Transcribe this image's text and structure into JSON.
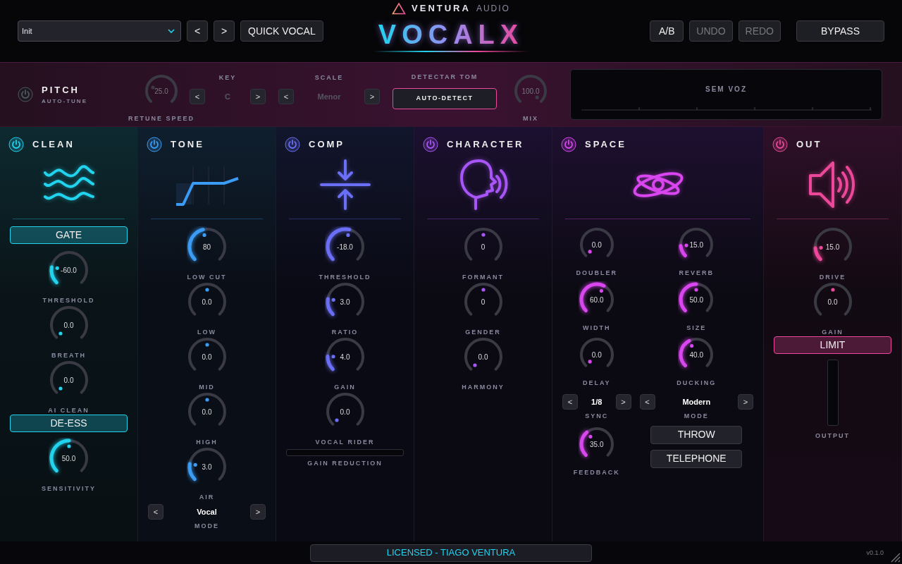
{
  "header": {
    "preset": {
      "value": "Init"
    },
    "nav": [
      "<",
      ">"
    ],
    "quick_vocal": "QUICK VOCAL",
    "brand": {
      "name": "VENTURA",
      "suffix": "AUDIO"
    },
    "title": "VOCALX",
    "buttons": [
      {
        "label": "A/B",
        "disabled": false
      },
      {
        "label": "UNDO",
        "disabled": true
      },
      {
        "label": "REDO",
        "disabled": true
      }
    ],
    "bypass": "BYPASS"
  },
  "pitch": {
    "on": false,
    "title": "PITCH",
    "subtitle": "AUTO-TUNE",
    "retune": {
      "value": "25.0",
      "label": "RETUNE SPEED"
    },
    "key": {
      "label": "KEY",
      "prev": "<",
      "value": "C",
      "next": ">"
    },
    "scale": {
      "label": "SCALE",
      "prev": "<",
      "value": "Menor",
      "next": ">"
    },
    "detect": {
      "label": "DETECTAR TOM",
      "button": "AUTO-DETECT"
    },
    "mix": {
      "value": "100.0",
      "label": "MIX"
    },
    "display": {
      "text": "SEM VOZ"
    }
  },
  "modules": [
    {
      "title": "CLEAN",
      "on": true,
      "color": "#22d3ee",
      "columns": [
        [
          {
            "kind": "toggle",
            "label": "GATE",
            "on": true
          },
          {
            "kind": "knob",
            "value": "-60.0",
            "label": "THRESHOLD"
          },
          {
            "kind": "knob",
            "value": "0.0",
            "label": "BREATH"
          },
          {
            "kind": "knob",
            "value": "0.0",
            "label": "AI CLEAN"
          },
          {
            "kind": "toggle",
            "label": "DE-ESS",
            "on": true
          },
          {
            "kind": "knob",
            "value": "50.0",
            "label": "SENSITIVITY"
          }
        ]
      ]
    },
    {
      "title": "TONE",
      "on": true,
      "color": "#3b9cf5",
      "columns": [
        [
          {
            "kind": "knob",
            "value": "80",
            "label": "LOW CUT"
          },
          {
            "kind": "knob",
            "value": "0.0",
            "label": "LOW"
          },
          {
            "kind": "knob",
            "value": "0.0",
            "label": "MID"
          },
          {
            "kind": "knob",
            "value": "0.0",
            "label": "HIGH"
          },
          {
            "kind": "knob",
            "value": "3.0",
            "label": "AIR"
          },
          {
            "kind": "stepper",
            "prev": "<",
            "value": "Vocal",
            "next": ">",
            "label": "MODE"
          }
        ]
      ]
    },
    {
      "title": "COMP",
      "on": true,
      "color": "#6a6ff5",
      "columns": [
        [
          {
            "kind": "knob",
            "value": "-18.0",
            "label": "THRESHOLD"
          },
          {
            "kind": "knob",
            "value": "3.0",
            "label": "RATIO"
          },
          {
            "kind": "knob",
            "value": "4.0",
            "label": "GAIN"
          },
          {
            "kind": "knob",
            "value": "0.0",
            "label": "VOCAL RIDER"
          },
          {
            "kind": "hmeter",
            "label": "GAIN REDUCTION",
            "level": 0
          }
        ]
      ]
    },
    {
      "title": "CHARACTER",
      "on": true,
      "color": "#a855f7",
      "columns": [
        [
          {
            "kind": "knob",
            "value": "0",
            "label": "FORMANT"
          },
          {
            "kind": "knob",
            "value": "0",
            "label": "GENDER"
          },
          {
            "kind": "knob",
            "value": "0.0",
            "label": "HARMONY"
          }
        ]
      ]
    },
    {
      "title": "SPACE",
      "on": true,
      "color": "#d946ef",
      "columns": [
        [
          {
            "kind": "knob",
            "value": "0.0",
            "label": "DOUBLER"
          },
          {
            "kind": "knob",
            "value": "60.0",
            "label": "WIDTH"
          },
          {
            "kind": "knob",
            "value": "0.0",
            "label": "DELAY"
          },
          {
            "kind": "stepper",
            "prev": "<",
            "value": "1/8",
            "next": ">",
            "label": "SYNC"
          },
          {
            "kind": "knob",
            "value": "35.0",
            "label": "FEEDBACK"
          }
        ],
        [
          {
            "kind": "knob",
            "value": "15.0",
            "label": "REVERB"
          },
          {
            "kind": "knob",
            "value": "50.0",
            "label": "SIZE"
          },
          {
            "kind": "knob",
            "value": "40.0",
            "label": "DUCKING"
          },
          {
            "kind": "stepper",
            "prev": "<",
            "value": "Modern",
            "next": ">",
            "label": "MODE"
          },
          {
            "kind": "toggle",
            "label": "THROW",
            "on": false
          },
          {
            "kind": "toggle",
            "label": "TELEPHONE",
            "on": false
          }
        ]
      ]
    },
    {
      "title": "OUT",
      "on": true,
      "color": "#ec4899",
      "columns": [
        [
          {
            "kind": "knob",
            "value": "15.0",
            "label": "DRIVE"
          },
          {
            "kind": "knob",
            "value": "0.0",
            "label": "GAIN"
          },
          {
            "kind": "toggle",
            "label": "LIMIT",
            "on": true
          },
          {
            "kind": "vmeter",
            "label": "OUTPUT",
            "level": 0
          }
        ]
      ]
    }
  ],
  "footer": {
    "license": "LICENSED - TIAGO VENTURA",
    "version": "v0.1.0"
  }
}
